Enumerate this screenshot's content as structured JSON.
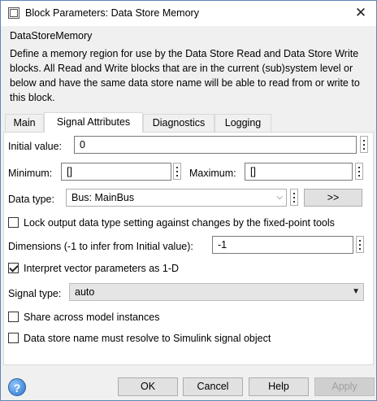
{
  "window": {
    "title": "Block Parameters: Data Store Memory",
    "close_glyph": "✕"
  },
  "block": {
    "type_name": "DataStoreMemory",
    "description": "Define a memory region for use by the Data Store Read and Data Store Write blocks. All Read and Write blocks that are in the current (sub)system level or below and have the same data store name will be able to read from or write to this block."
  },
  "tabs": [
    "Main",
    "Signal Attributes",
    "Diagnostics",
    "Logging"
  ],
  "active_tab": "Signal Attributes",
  "params": {
    "initial_value_label": "Initial value:",
    "initial_value": "0",
    "minimum_label": "Minimum:",
    "minimum": "[]",
    "maximum_label": "Maximum:",
    "maximum": "[]",
    "data_type_label": "Data type:",
    "data_type": "Bus: MainBus",
    "data_type_assistant": ">>",
    "lock_label": "Lock output data type setting against changes by the fixed-point tools",
    "lock_checked": false,
    "dimensions_label": "Dimensions (-1 to infer from Initial value):",
    "dimensions": "-1",
    "interpret_label": "Interpret vector parameters as 1-D",
    "interpret_checked": true,
    "signal_type_label": "Signal type:",
    "signal_type": "auto",
    "share_label": "Share across model instances",
    "share_checked": false,
    "resolve_label": "Data store name must resolve to Simulink signal object",
    "resolve_checked": false
  },
  "buttons": {
    "ok": "OK",
    "cancel": "Cancel",
    "help": "Help",
    "apply": "Apply",
    "help_icon": "?"
  }
}
